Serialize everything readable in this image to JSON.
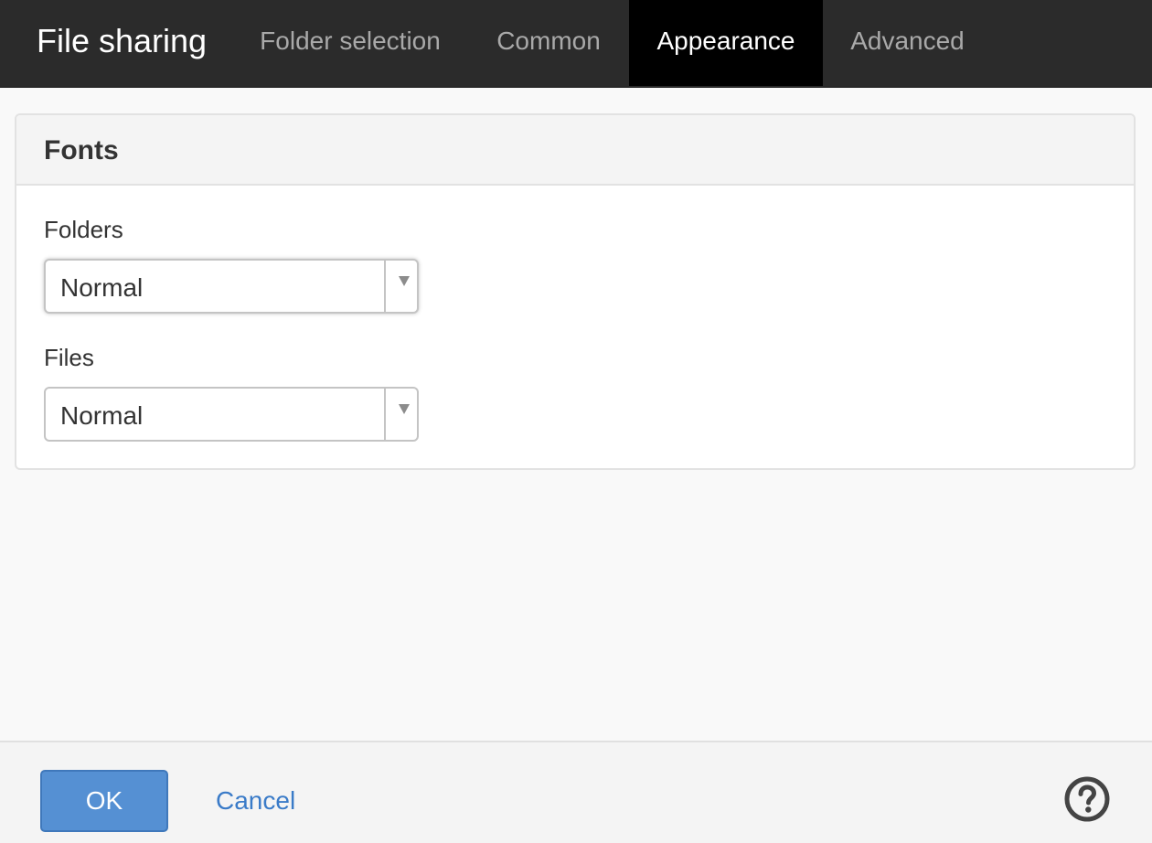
{
  "app": {
    "title": "File sharing"
  },
  "tabs": [
    {
      "label": "Folder selection",
      "active": false
    },
    {
      "label": "Common",
      "active": false
    },
    {
      "label": "Appearance",
      "active": true
    },
    {
      "label": "Advanced",
      "active": false
    }
  ],
  "fonts_panel": {
    "title": "Fonts",
    "folders": {
      "label": "Folders",
      "value": "Normal"
    },
    "files": {
      "label": "Files",
      "value": "Normal"
    }
  },
  "footer": {
    "ok_label": "OK",
    "cancel_label": "Cancel",
    "help_icon": "question-circle-icon"
  },
  "colors": {
    "topbar_bg": "#2b2b2b",
    "active_tab_bg": "#000000",
    "ok_button": "#5590d3",
    "link": "#3a7bc8"
  }
}
